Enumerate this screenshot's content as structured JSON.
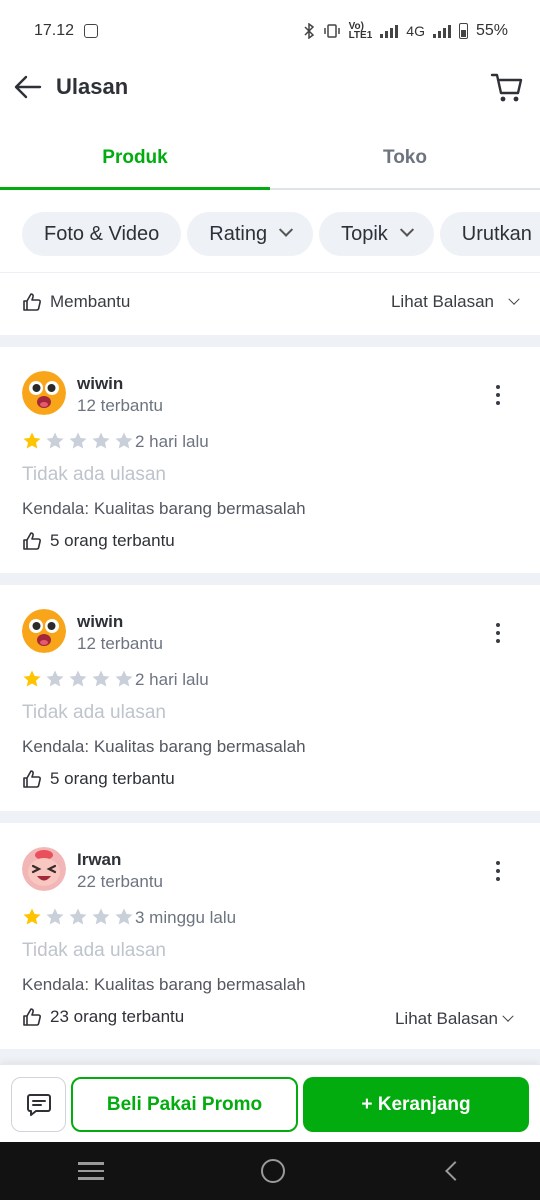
{
  "status_bar": {
    "time": "17.12",
    "network_label_top": "Vo)",
    "network_label_bottom": "LTE1",
    "network_type": "4G",
    "battery": "55%"
  },
  "header": {
    "title": "Ulasan"
  },
  "tabs": [
    {
      "label": "Produk",
      "active": true
    },
    {
      "label": "Toko",
      "active": false
    }
  ],
  "filters": [
    {
      "label": "Foto & Video",
      "has_dropdown": false
    },
    {
      "label": "Rating",
      "has_dropdown": true
    },
    {
      "label": "Topik",
      "has_dropdown": true
    },
    {
      "label": "Urutkan",
      "has_dropdown": true
    }
  ],
  "help_row": {
    "label": "Membantu",
    "replies_label": "Lihat Balasan"
  },
  "reviews": [
    {
      "name": "wiwin",
      "helped_count": "12 terbantu",
      "rating": 1,
      "date": "2 hari lalu",
      "text": "Tidak ada ulasan",
      "issue": "Kendala: Kualitas barang bermasalah",
      "helpful": "5 orang terbantu",
      "avatar": "surprised-face-avatar"
    },
    {
      "name": "wiwin",
      "helped_count": "12 terbantu",
      "rating": 1,
      "date": "2 hari lalu",
      "text": "Tidak ada ulasan",
      "issue": "Kendala: Kualitas barang bermasalah",
      "helpful": "5 orang terbantu",
      "avatar": "surprised-face-avatar"
    },
    {
      "name": "Irwan",
      "helped_count": "22 terbantu",
      "rating": 1,
      "date": "3 minggu lalu",
      "text": "Tidak ada ulasan",
      "issue": "Kendala: Kualitas barang bermasalah",
      "helpful": "23 orang terbantu",
      "replies_label": "Lihat Balasan",
      "avatar": "laughing-monkey-avatar"
    }
  ],
  "bottom_bar": {
    "promo_label": "Beli Pakai Promo",
    "cart_label": "+ Keranjang"
  },
  "colors": {
    "brand_green": "#03ac0e",
    "star_filled": "#ffc400",
    "star_empty": "#c9d0da",
    "band": "#eef1f5"
  },
  "icons": {
    "back": "arrow-left-icon",
    "cart": "cart-icon",
    "chat": "chat-icon",
    "thumb": "thumbs-up-icon",
    "more": "kebab-icon"
  }
}
